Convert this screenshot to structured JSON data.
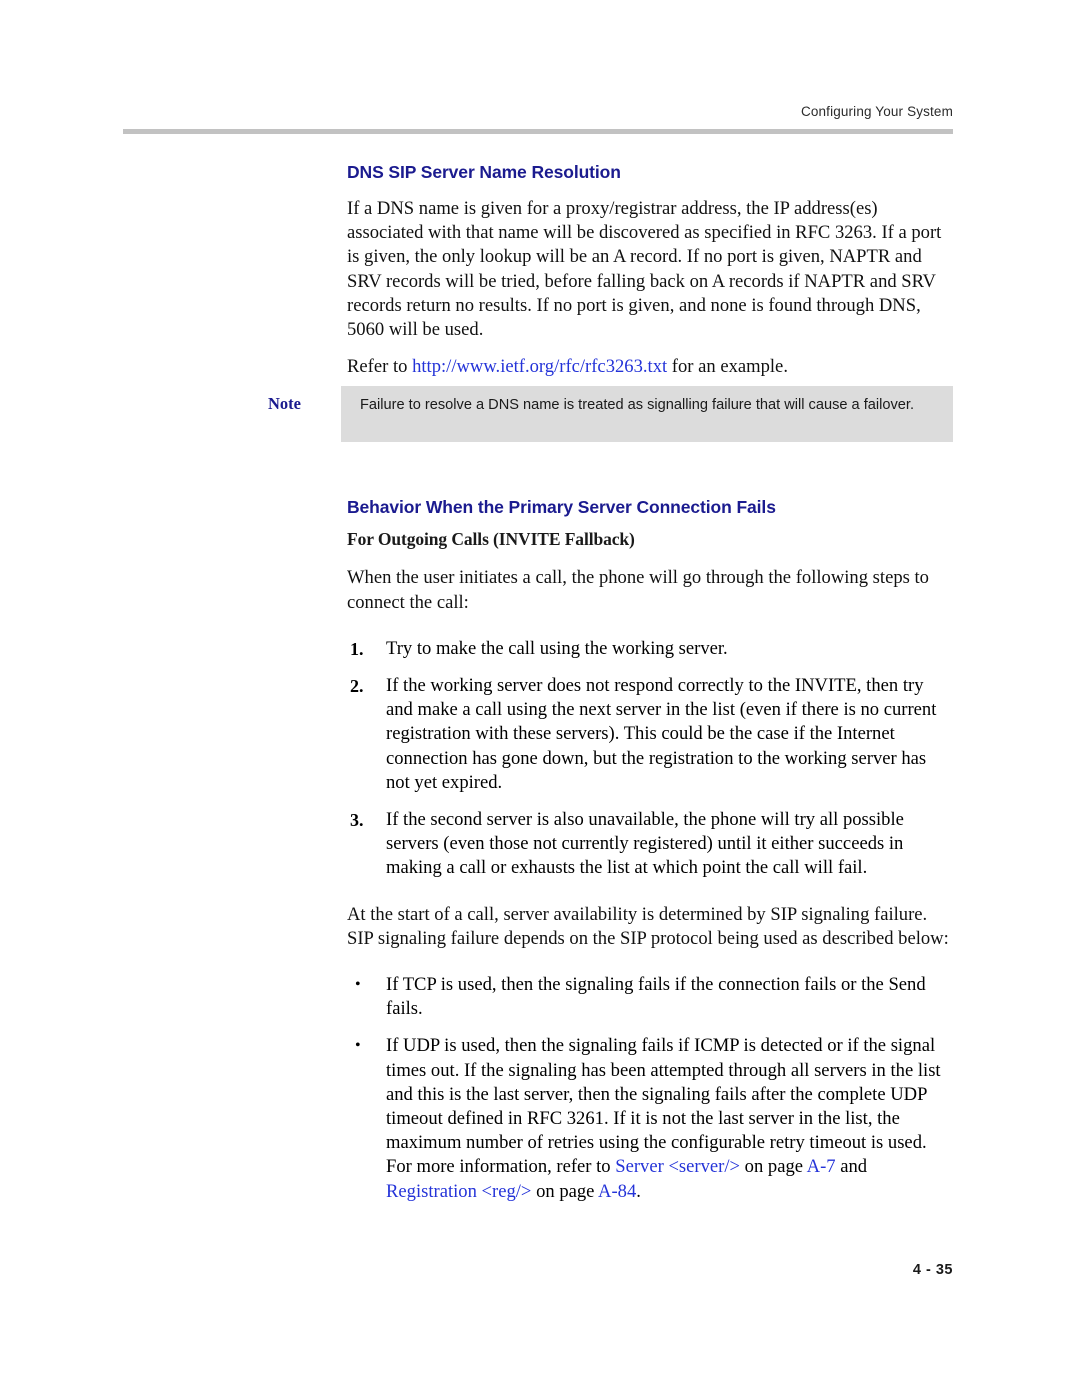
{
  "header": {
    "running_head": "Configuring Your System"
  },
  "sections": {
    "dns": {
      "heading": "DNS SIP Server Name Resolution",
      "paragraph": "If a DNS name is given for a proxy/registrar address, the IP address(es) associated with that name will be discovered as specified in RFC 3263. If a port is given, the only lookup will be an A record. If no port is given, NAPTR and SRV records will be tried, before falling back on A records if NAPTR and SRV records return no results. If no port is given, and none is found through DNS, 5060 will be used.",
      "refer_prefix": "Refer to ",
      "refer_link": "http://www.ietf.org/rfc/rfc3263.txt",
      "refer_suffix": " for an example."
    },
    "note": {
      "label": "Note",
      "text": "Failure to resolve a DNS name is treated as signalling failure that will cause a failover."
    },
    "behavior": {
      "heading": "Behavior When the Primary Server Connection Fails",
      "subheading": "For Outgoing Calls (INVITE Fallback)",
      "intro": "When the user initiates a call, the phone will go through the following steps to connect the call:",
      "steps": [
        {
          "num": "1.",
          "text": "Try to make the call using the working server."
        },
        {
          "num": "2.",
          "text": "If the working server does not respond correctly to the INVITE, then try and make a call using the next server in the list (even if there is no current registration with these servers). This could be the case if the Internet connection has gone down, but the registration to the working server has not yet expired."
        },
        {
          "num": "3.",
          "text": "If the second server is also unavailable, the phone will try all possible servers (even those not currently registered) until it either succeeds in making a call or exhausts the list at which point the call will fail."
        }
      ],
      "availability_paragraph": "At the start of a call, server availability is determined by SIP signaling failure. SIP signaling failure depends on the SIP protocol being used as described below:",
      "bullets": [
        {
          "dot": "•",
          "text": "If TCP is used, then the signaling fails if the connection fails or the Send fails."
        }
      ],
      "udp_bullet": {
        "dot": "•",
        "text_part_1": "If UDP is used, then the signaling fails if ICMP is detected or if the signal times out. If the signaling has been attempted through all servers in the list and this is the last server, then the signaling fails after the complete UDP timeout defined in RFC 3261. If it is not the last server in the list, the maximum number of retries using the configurable retry timeout is used. For more information, refer to ",
        "link_1": "Server <server/>",
        "mid_1": " on page ",
        "link_2": "A-7",
        "mid_2": " and ",
        "link_3": "Registration <reg/>",
        "mid_3": " on page ",
        "link_4": "A-84",
        "end": "."
      }
    }
  },
  "footer": {
    "page_number": "4 - 35"
  }
}
